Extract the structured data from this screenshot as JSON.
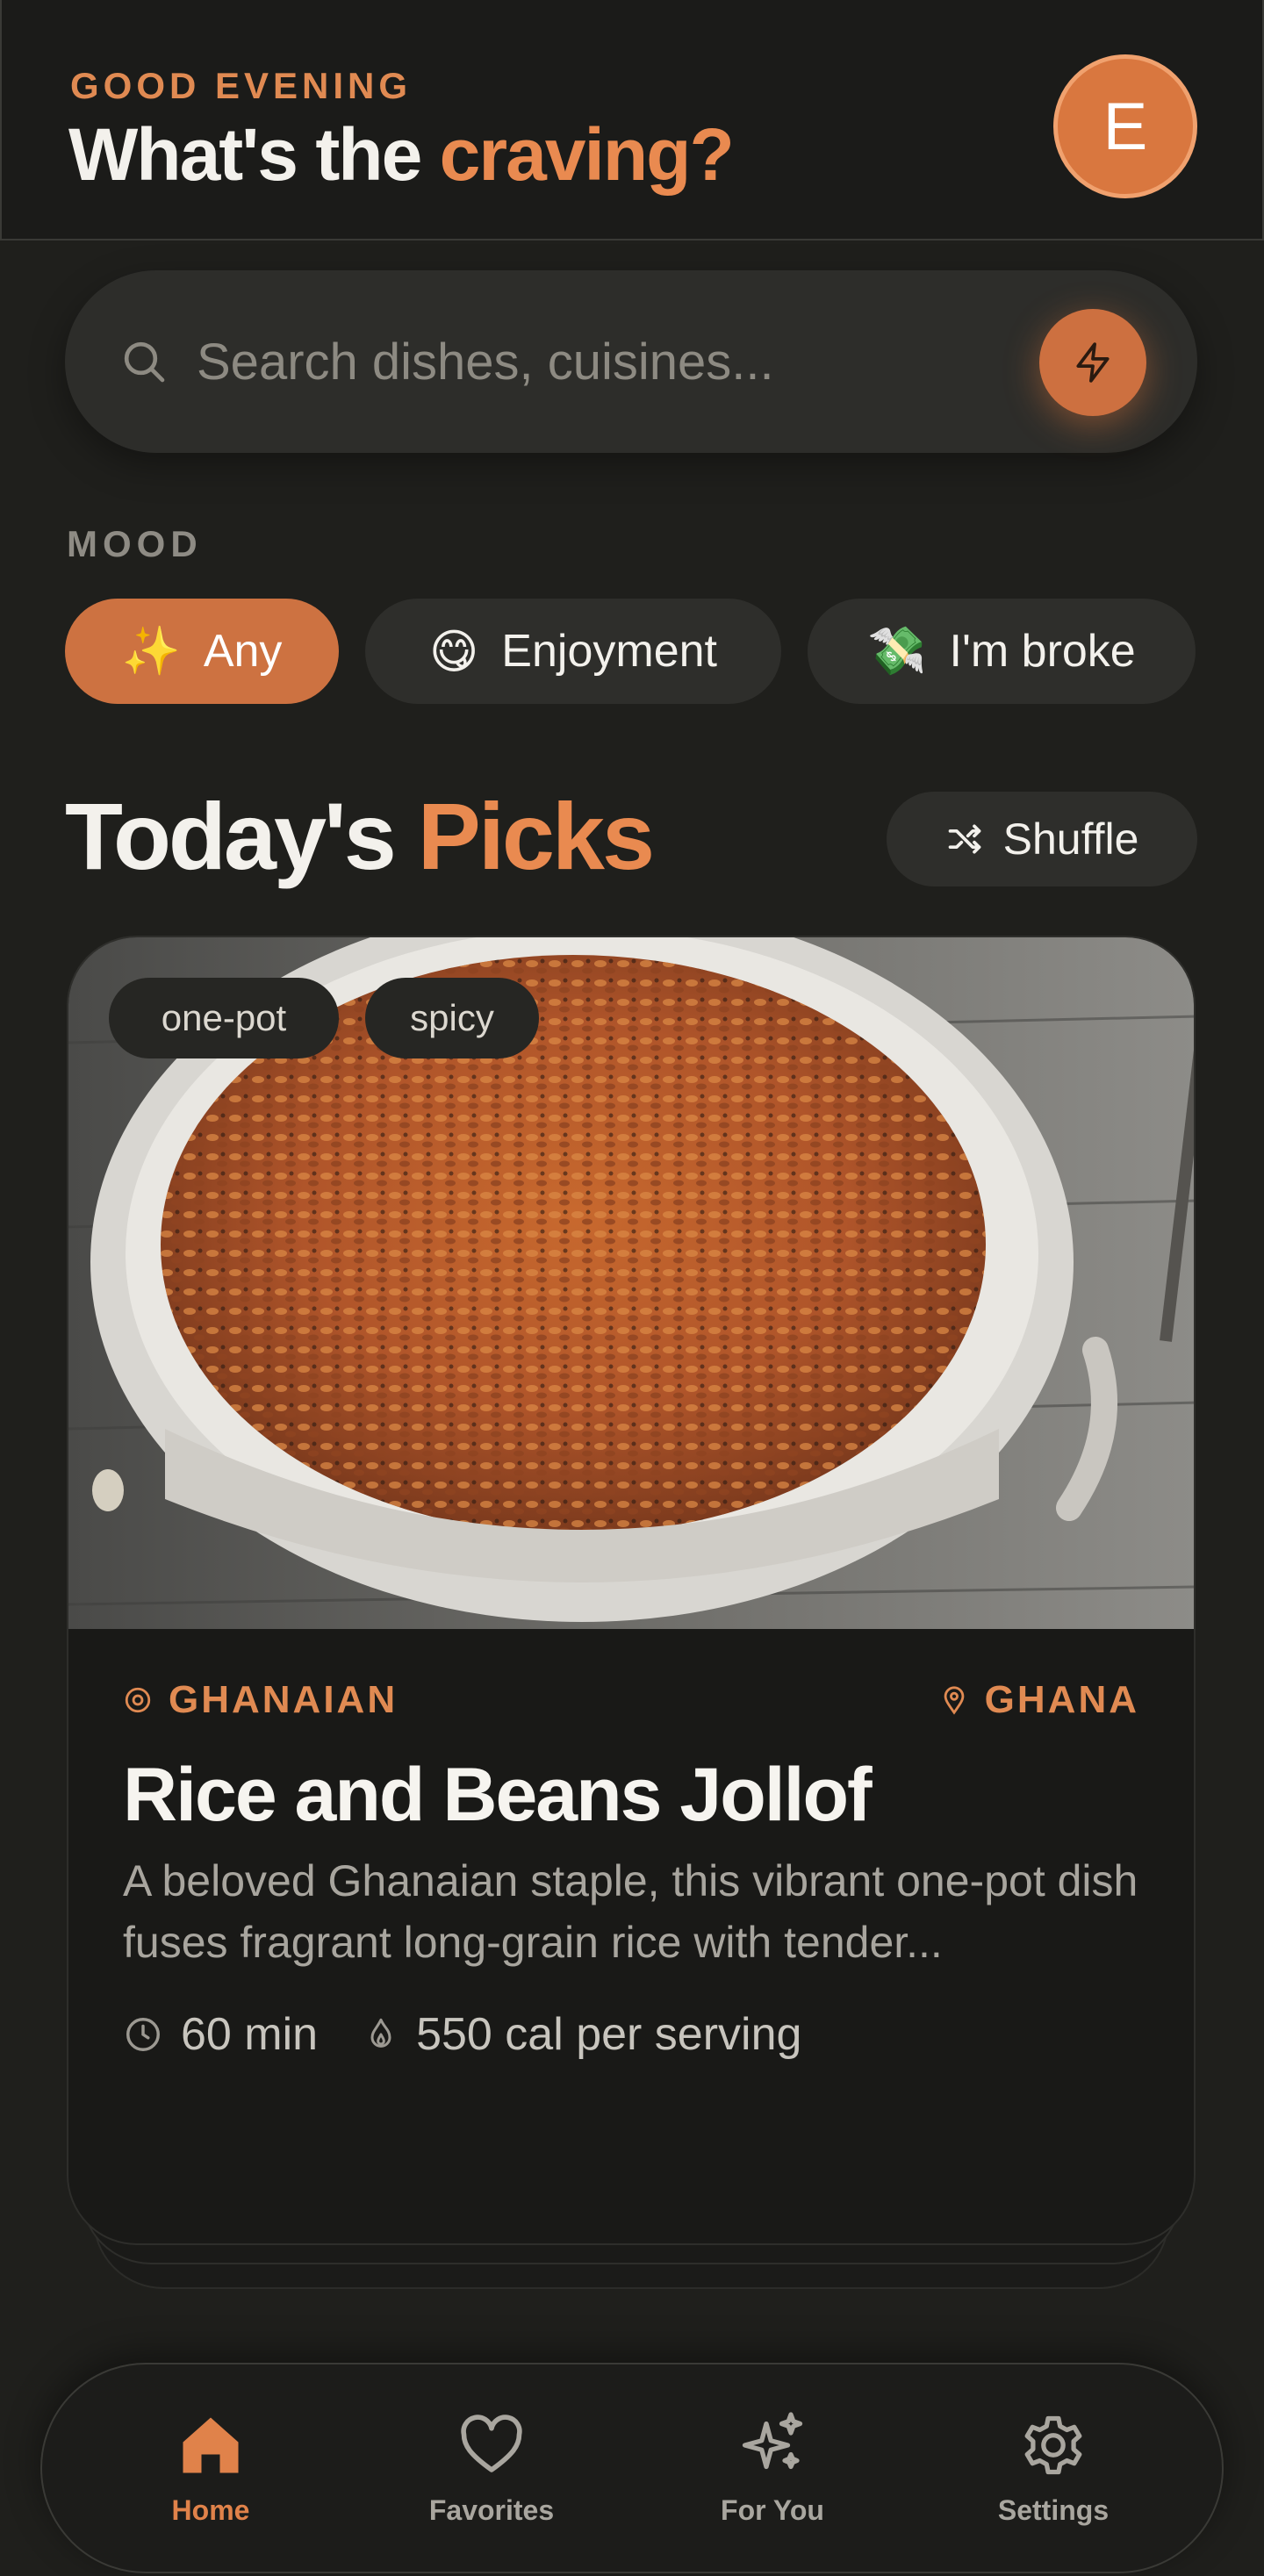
{
  "header": {
    "greeting": "GOOD EVENING",
    "title_main": "What's the",
    "title_accent": "craving?",
    "avatar_initial": "E"
  },
  "search": {
    "placeholder": "Search dishes, cuisines...",
    "value": ""
  },
  "mood": {
    "label": "MOOD",
    "chips": [
      {
        "emoji": "✨",
        "label": "Any",
        "active": true
      },
      {
        "emoji": "😋",
        "label": "Enjoyment",
        "active": false
      },
      {
        "emoji": "💸",
        "label": "I'm broke",
        "active": false
      }
    ]
  },
  "picks": {
    "title_main": "Today's",
    "title_accent": "Picks",
    "shuffle_label": "Shuffle"
  },
  "card": {
    "tags": [
      "one-pot",
      "spicy"
    ],
    "cuisine": "GHANAIAN",
    "origin": "GHANA",
    "name": "Rice and Beans Jollof",
    "description": "A beloved Ghanaian staple, this vibrant one-pot dish fuses fragrant long-grain rice with tender...",
    "time": "60 min",
    "calories": "550 cal per serving"
  },
  "nav": {
    "items": [
      {
        "label": "Home",
        "icon": "home-icon",
        "active": true
      },
      {
        "label": "Favorites",
        "icon": "heart-icon",
        "active": false
      },
      {
        "label": "For You",
        "icon": "sparkles-icon",
        "active": false
      },
      {
        "label": "Settings",
        "icon": "gear-icon",
        "active": false
      }
    ]
  },
  "colors": {
    "background": "#1f1f1c",
    "accent": "#e98a50",
    "surface": "#2e2e2b"
  }
}
